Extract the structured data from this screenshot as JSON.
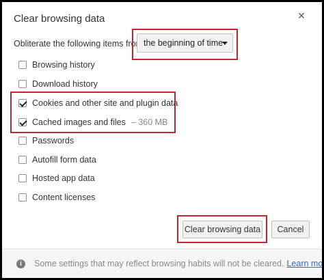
{
  "dialog": {
    "title": "Clear browsing data",
    "close_glyph": "×"
  },
  "range": {
    "label": "Obliterate the following items from:",
    "selected": "the beginning of time"
  },
  "items": [
    {
      "label": "Browsing history",
      "checked": false,
      "size": ""
    },
    {
      "label": "Download history",
      "checked": false,
      "size": ""
    },
    {
      "label": "Cookies and other site and plugin data",
      "checked": true,
      "size": ""
    },
    {
      "label": "Cached images and files",
      "checked": true,
      "size": "– 360 MB"
    },
    {
      "label": "Passwords",
      "checked": false,
      "size": ""
    },
    {
      "label": "Autofill form data",
      "checked": false,
      "size": ""
    },
    {
      "label": "Hosted app data",
      "checked": false,
      "size": ""
    },
    {
      "label": "Content licenses",
      "checked": false,
      "size": ""
    }
  ],
  "buttons": {
    "clear": "Clear browsing data",
    "cancel": "Cancel"
  },
  "footer": {
    "icon": "info-icon",
    "text": "Some settings that may reflect browsing habits will not be cleared.",
    "link": "Learn more"
  },
  "colors": {
    "highlight": "#c0272d",
    "link": "#3367d6"
  }
}
